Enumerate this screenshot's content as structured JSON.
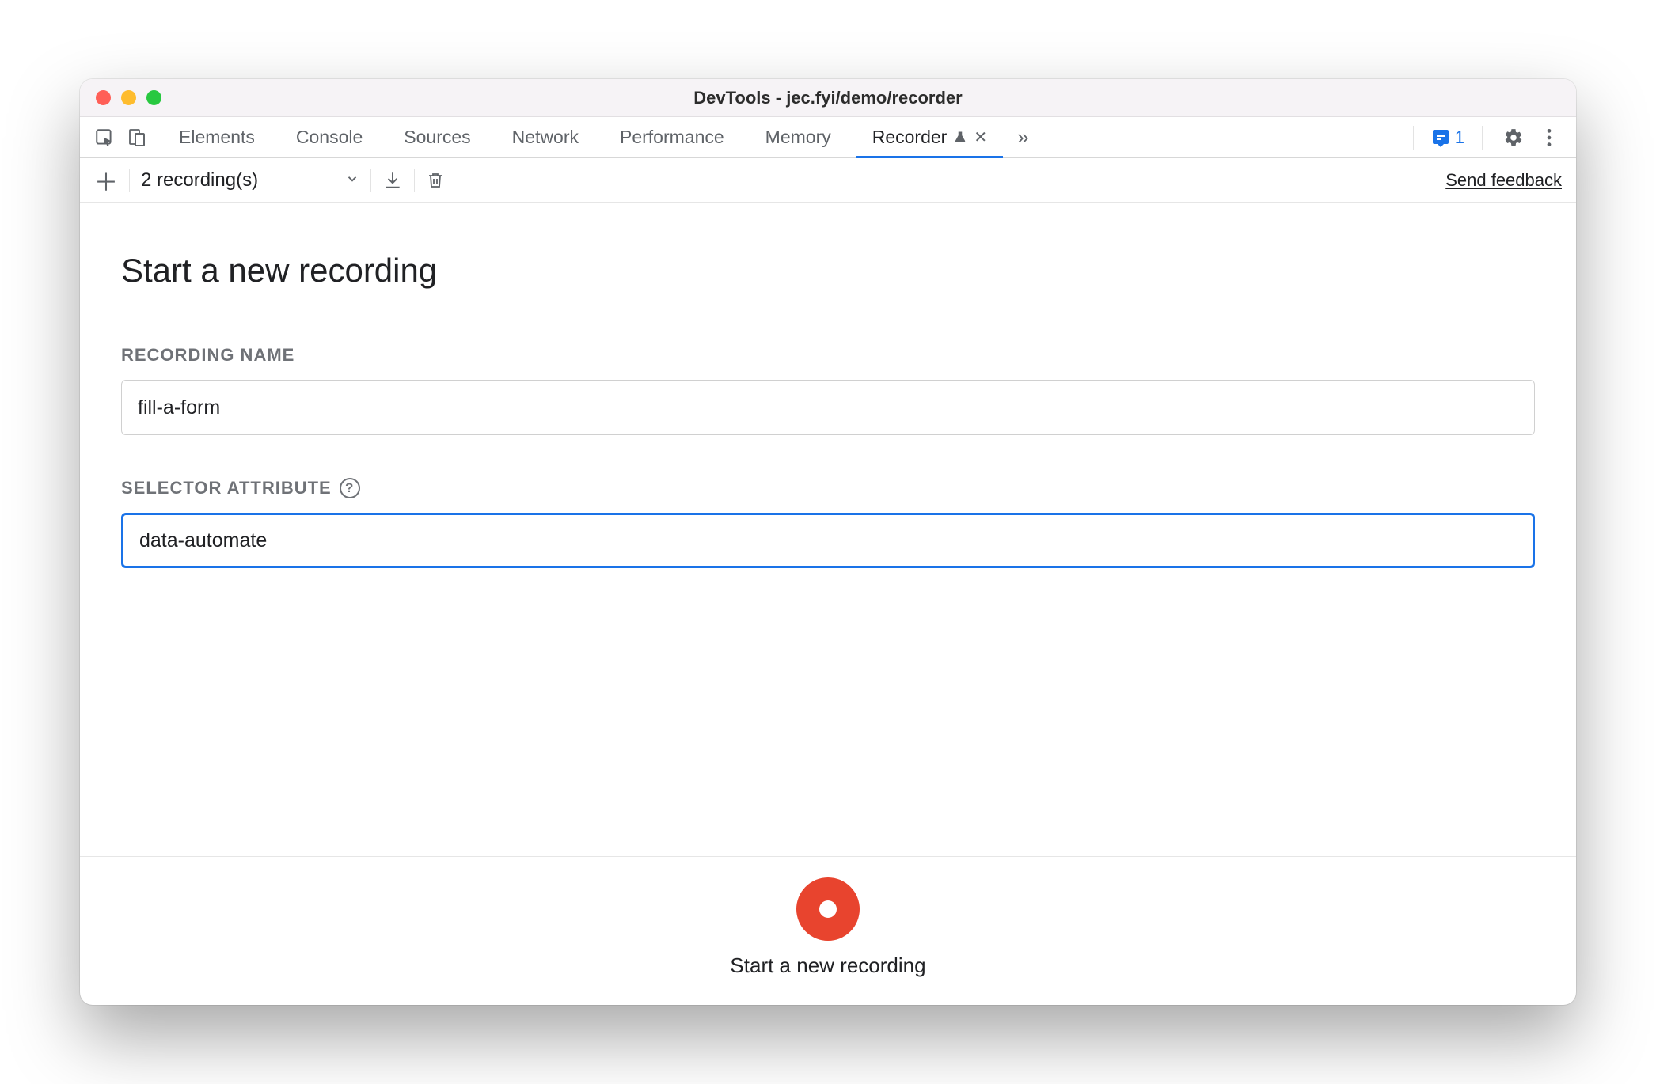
{
  "window": {
    "title": "DevTools - jec.fyi/demo/recorder"
  },
  "tabs": {
    "items": [
      "Elements",
      "Console",
      "Sources",
      "Network",
      "Performance",
      "Memory"
    ],
    "active": {
      "label": "Recorder"
    }
  },
  "issues": {
    "count": "1"
  },
  "toolbar": {
    "recording_count_label": "2 recording(s)",
    "feedback": "Send feedback"
  },
  "page": {
    "title": "Start a new recording"
  },
  "fields": {
    "name": {
      "label": "RECORDING NAME",
      "value": "fill-a-form"
    },
    "selector": {
      "label": "SELECTOR ATTRIBUTE",
      "value": "data-automate"
    }
  },
  "footer": {
    "record_label": "Start a new recording"
  }
}
